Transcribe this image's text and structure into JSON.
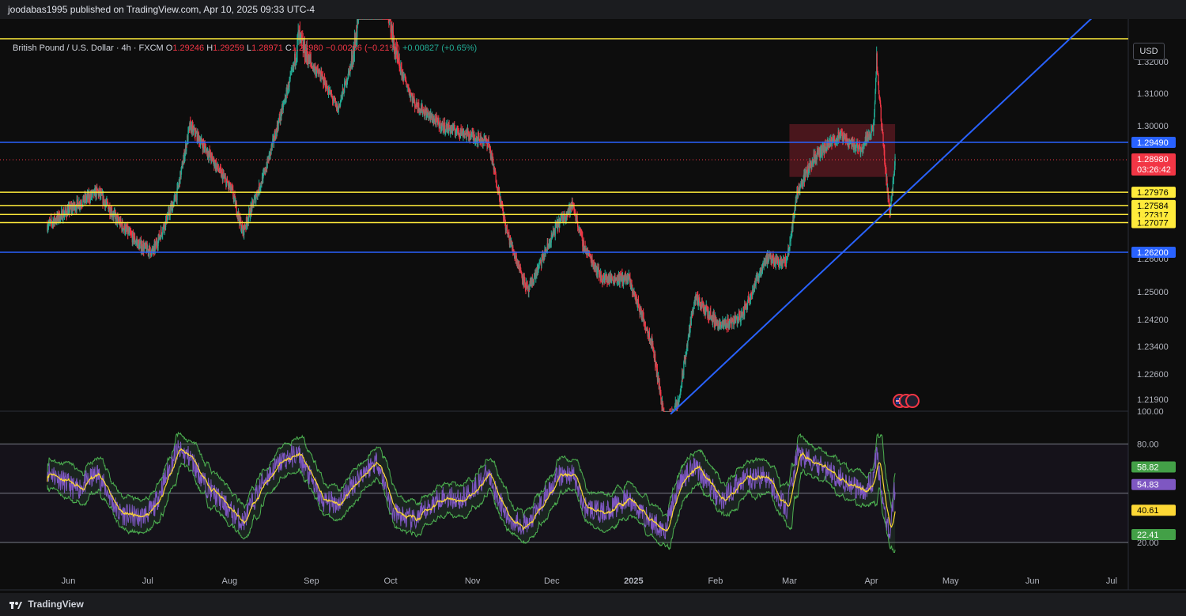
{
  "header": {
    "published": "joodabas1995 published on TradingView.com, Apr 10, 2025 09:33 UTC-4"
  },
  "legend": {
    "symbol": "British Pound / U.S. Dollar · 4h · FXCM",
    "o_label": "O",
    "o_value": "1.29246",
    "h_label": "H",
    "h_value": "1.29259",
    "l_label": "L",
    "l_value": "1.28971",
    "c_label": "C",
    "c_value": "1.28980",
    "change": "−0.00266 (−0.21%)",
    "extra": "+0.00827 (+0.65%)"
  },
  "currency": "USD",
  "footer": {
    "brand": "TradingView"
  },
  "colors": {
    "up": "#22ab94",
    "down": "#f23645",
    "yellow_line": "#ffeb3b",
    "blue_line": "#2962ff",
    "zone": "#7b1f2a",
    "rsi": "#7e57c2",
    "rsi_ma": "#fdd835",
    "band": "#4caf50"
  },
  "chart_data": [
    {
      "type": "candlestick",
      "title": "British Pound / U.S. Dollar · 4h · FXCM",
      "x_tick_labels": [
        "Jun",
        "Jul",
        "Aug",
        "Sep",
        "Oct",
        "Nov",
        "Dec",
        "2025",
        "Feb",
        "Mar",
        "Apr",
        "May",
        "Jun",
        "Jul"
      ],
      "y_tick_labels": [
        "1.32000",
        "1.31000",
        "1.30000",
        "1.26000",
        "1.25000",
        "1.24200",
        "1.23400",
        "1.22600",
        "1.21900"
      ],
      "price_scale_anchors": [
        {
          "price": 1.3236,
          "row": 49
        },
        {
          "price": 1.32,
          "row": 78
        },
        {
          "price": 1.31,
          "row": 118
        },
        {
          "price": 1.3,
          "row": 159
        },
        {
          "price": 1.2949,
          "row": 180
        },
        {
          "price": 1.2898,
          "row": 202
        },
        {
          "price": 1.2798,
          "row": 243
        },
        {
          "price": 1.262,
          "row": 319
        },
        {
          "price": 1.26,
          "row": 327
        },
        {
          "price": 1.25,
          "row": 369
        },
        {
          "price": 1.242,
          "row": 404
        },
        {
          "price": 1.234,
          "row": 438
        },
        {
          "price": 1.226,
          "row": 473
        },
        {
          "price": 1.219,
          "row": 505
        },
        {
          "price": 1.216,
          "row": 519
        }
      ],
      "price_path": [
        [
          "2024-05-24",
          1.27
        ],
        [
          "2024-06-04",
          1.276
        ],
        [
          "2024-06-12",
          1.28
        ],
        [
          "2024-06-20",
          1.271
        ],
        [
          "2024-06-28",
          1.264
        ],
        [
          "2024-07-03",
          1.262
        ],
        [
          "2024-07-12",
          1.279
        ],
        [
          "2024-07-17",
          1.3
        ],
        [
          "2024-07-23",
          1.293
        ],
        [
          "2024-08-02",
          1.28
        ],
        [
          "2024-08-06",
          1.268
        ],
        [
          "2024-08-14",
          1.285
        ],
        [
          "2024-08-21",
          1.305
        ],
        [
          "2024-08-27",
          1.324
        ],
        [
          "2024-09-05",
          1.315
        ],
        [
          "2024-09-11",
          1.305
        ],
        [
          "2024-09-20",
          1.33
        ],
        [
          "2024-09-26",
          1.342
        ],
        [
          "2024-10-02",
          1.323
        ],
        [
          "2024-10-10",
          1.307
        ],
        [
          "2024-10-20",
          1.3
        ],
        [
          "2024-10-28",
          1.298
        ],
        [
          "2024-11-07",
          1.295
        ],
        [
          "2024-11-14",
          1.268
        ],
        [
          "2024-11-22",
          1.25
        ],
        [
          "2024-12-03",
          1.27
        ],
        [
          "2024-12-09",
          1.276
        ],
        [
          "2024-12-13",
          1.264
        ],
        [
          "2024-12-20",
          1.254
        ],
        [
          "2024-12-30",
          1.254
        ],
        [
          "2025-01-08",
          1.235
        ],
        [
          "2025-01-13",
          1.212
        ],
        [
          "2025-01-18",
          1.218
        ],
        [
          "2025-01-24",
          1.248
        ],
        [
          "2025-02-03",
          1.24
        ],
        [
          "2025-02-11",
          1.243
        ],
        [
          "2025-02-20",
          1.26
        ],
        [
          "2025-02-28",
          1.259
        ],
        [
          "2025-03-04",
          1.28
        ],
        [
          "2025-03-10",
          1.29
        ],
        [
          "2025-03-20",
          1.297
        ],
        [
          "2025-03-28",
          1.293
        ],
        [
          "2025-04-02",
          1.3
        ],
        [
          "2025-04-03",
          1.32
        ],
        [
          "2025-04-05",
          1.299
        ],
        [
          "2025-04-08",
          1.273
        ],
        [
          "2025-04-10",
          1.2898
        ]
      ],
      "horizontal_levels": [
        {
          "price": 1.3236,
          "color": "yellow"
        },
        {
          "price": 1.2949,
          "color": "blue",
          "label": "1.29490"
        },
        {
          "price": 1.27976,
          "color": "yellow",
          "label": "1.27976"
        },
        {
          "price": 1.27584,
          "color": "yellow",
          "label": "1.27584"
        },
        {
          "price": 1.27317,
          "color": "yellow",
          "label": "1.27317"
        },
        {
          "price": 1.27077,
          "color": "yellow",
          "label": "1.27077"
        },
        {
          "price": 1.262,
          "color": "blue",
          "label": "1.26200"
        }
      ],
      "trendline": {
        "from": [
          "2025-01-15",
          1.215
        ],
        "to": [
          "2025-07-17",
          1.336
        ],
        "color": "blue"
      },
      "zone": {
        "x_from": "2025-03-01",
        "x_to": "2025-04-10",
        "price_top": 1.3005,
        "price_bottom": 1.2845
      },
      "last_price": {
        "label": "1.28980",
        "countdown": "03:26:42"
      }
    },
    {
      "type": "line",
      "title": "",
      "y_tick_labels": [
        "100.00",
        "80.00",
        "20.00"
      ],
      "ylim": [
        20,
        100
      ],
      "reference_lines": [
        80,
        50,
        20
      ],
      "series": [
        {
          "values_labeled": {
            "upper_band": "58.82",
            "rsi": "54.83",
            "rsi_ma": "40.61",
            "lower_band": "22.41"
          }
        }
      ],
      "rsi_path": [
        [
          "2024-05-24",
          64
        ],
        [
          "2024-06-04",
          52
        ],
        [
          "2024-06-12",
          62
        ],
        [
          "2024-06-20",
          38
        ],
        [
          "2024-06-28",
          35
        ],
        [
          "2024-07-03",
          40
        ],
        [
          "2024-07-12",
          76
        ],
        [
          "2024-07-17",
          72
        ],
        [
          "2024-07-23",
          55
        ],
        [
          "2024-08-02",
          38
        ],
        [
          "2024-08-06",
          32
        ],
        [
          "2024-08-14",
          58
        ],
        [
          "2024-08-21",
          70
        ],
        [
          "2024-08-27",
          74
        ],
        [
          "2024-09-05",
          45
        ],
        [
          "2024-09-11",
          44
        ],
        [
          "2024-09-20",
          62
        ],
        [
          "2024-09-26",
          70
        ],
        [
          "2024-10-02",
          38
        ],
        [
          "2024-10-10",
          33
        ],
        [
          "2024-10-20",
          48
        ],
        [
          "2024-10-28",
          46
        ],
        [
          "2024-11-07",
          62
        ],
        [
          "2024-11-14",
          35
        ],
        [
          "2024-11-22",
          30
        ],
        [
          "2024-12-03",
          60
        ],
        [
          "2024-12-09",
          62
        ],
        [
          "2024-12-13",
          42
        ],
        [
          "2024-12-20",
          38
        ],
        [
          "2024-12-30",
          46
        ],
        [
          "2025-01-08",
          32
        ],
        [
          "2025-01-13",
          28
        ],
        [
          "2025-01-18",
          55
        ],
        [
          "2025-01-24",
          68
        ],
        [
          "2025-02-03",
          45
        ],
        [
          "2025-02-11",
          58
        ],
        [
          "2025-02-20",
          60
        ],
        [
          "2025-02-28",
          40
        ],
        [
          "2025-03-04",
          74
        ],
        [
          "2025-03-10",
          68
        ],
        [
          "2025-03-20",
          60
        ],
        [
          "2025-03-28",
          50
        ],
        [
          "2025-04-02",
          58
        ],
        [
          "2025-04-03",
          78
        ],
        [
          "2025-04-05",
          45
        ],
        [
          "2025-04-08",
          26
        ],
        [
          "2025-04-10",
          54.83
        ]
      ]
    }
  ]
}
